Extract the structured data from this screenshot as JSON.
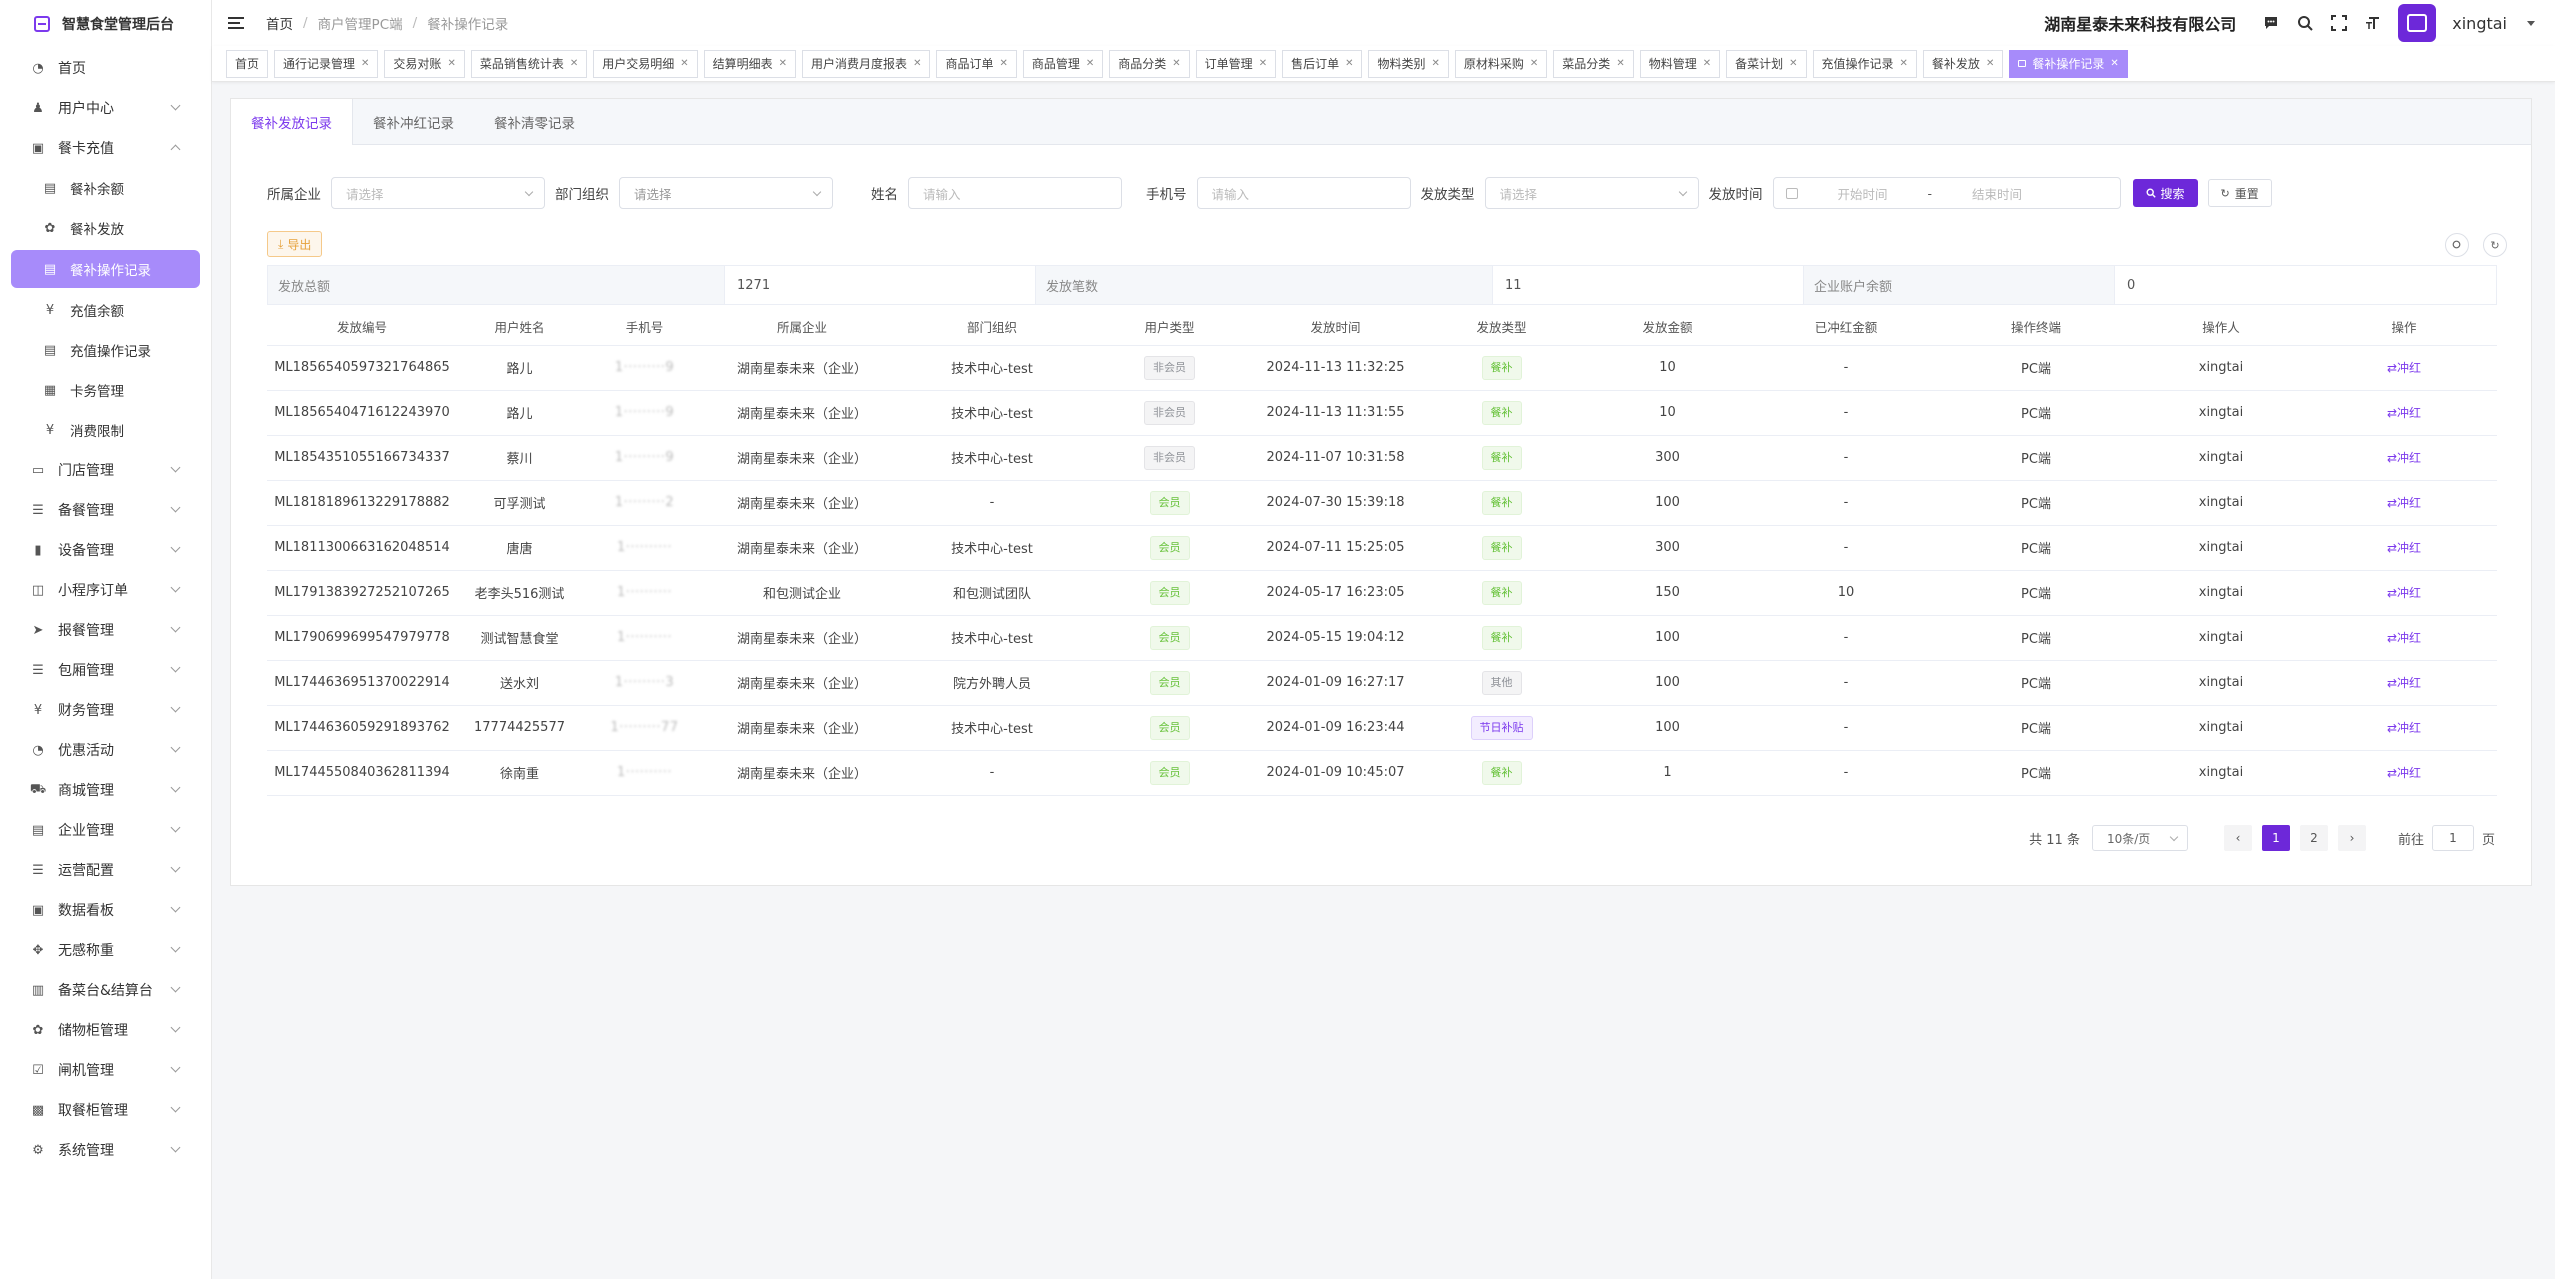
{
  "sidebar": {
    "app_title": "智慧食堂管理后台",
    "items": [
      {
        "label": "首页",
        "icon": "dashboard-icon",
        "glyph": "◔",
        "expand": ""
      },
      {
        "label": "用户中心",
        "icon": "user-icon",
        "glyph": "♟",
        "expand": "down"
      },
      {
        "label": "餐卡充值",
        "icon": "card-icon",
        "glyph": "▣",
        "expand": "up"
      },
      {
        "label": "餐补余额",
        "icon": "list-icon",
        "glyph": "▤",
        "sub": true
      },
      {
        "label": "餐补发放",
        "icon": "gear-icon",
        "glyph": "✿",
        "sub": true
      },
      {
        "label": "餐补操作记录",
        "icon": "record-icon",
        "glyph": "▤",
        "sub": true,
        "active": true
      },
      {
        "label": "充值余额",
        "icon": "yen-icon",
        "glyph": "¥",
        "sub": true
      },
      {
        "label": "充值操作记录",
        "icon": "record-icon",
        "glyph": "▤",
        "sub": true
      },
      {
        "label": "卡务管理",
        "icon": "card-icon",
        "glyph": "▦",
        "sub": true
      },
      {
        "label": "消费限制",
        "icon": "yen-icon",
        "glyph": "¥",
        "sub": true
      },
      {
        "label": "门店管理",
        "icon": "store-icon",
        "glyph": "▭",
        "expand": "down"
      },
      {
        "label": "备餐管理",
        "icon": "list-icon",
        "glyph": "☰",
        "expand": "down"
      },
      {
        "label": "设备管理",
        "icon": "chart-icon",
        "glyph": "▮",
        "expand": "down"
      },
      {
        "label": "小程序订单",
        "icon": "order-icon",
        "glyph": "◫",
        "expand": "down"
      },
      {
        "label": "报餐管理",
        "icon": "send-icon",
        "glyph": "➤",
        "expand": "down"
      },
      {
        "label": "包厢管理",
        "icon": "list-icon",
        "glyph": "☰",
        "expand": "down"
      },
      {
        "label": "财务管理",
        "icon": "yen-icon",
        "glyph": "¥",
        "expand": "down"
      },
      {
        "label": "优惠活动",
        "icon": "dashboard-icon",
        "glyph": "◔",
        "expand": "down"
      },
      {
        "label": "商城管理",
        "icon": "cart-icon",
        "glyph": "⛟",
        "expand": "down"
      },
      {
        "label": "企业管理",
        "icon": "building-icon",
        "glyph": "▤",
        "expand": "down"
      },
      {
        "label": "运营配置",
        "icon": "list-icon",
        "glyph": "☰",
        "expand": "down"
      },
      {
        "label": "数据看板",
        "icon": "board-icon",
        "glyph": "▣",
        "expand": "down"
      },
      {
        "label": "无感称重",
        "icon": "move-icon",
        "glyph": "✥",
        "expand": "down"
      },
      {
        "label": "备菜台&结算台",
        "icon": "desk-icon",
        "glyph": "▥",
        "expand": "down"
      },
      {
        "label": "储物柜管理",
        "icon": "gear-icon",
        "glyph": "✿",
        "expand": "down"
      },
      {
        "label": "闸机管理",
        "icon": "check-icon",
        "glyph": "☑",
        "expand": "down"
      },
      {
        "label": "取餐柜管理",
        "icon": "cabinet-icon",
        "glyph": "▩",
        "expand": "down"
      },
      {
        "label": "系统管理",
        "icon": "gear-icon",
        "glyph": "⚙",
        "expand": "down"
      }
    ]
  },
  "header": {
    "breadcrumb": [
      "首页",
      "商户管理PC端",
      "餐补操作记录"
    ],
    "company": "湖南星泰未来科技有限公司",
    "username": "xingtai"
  },
  "tags": [
    {
      "label": "首页",
      "closable": false
    },
    {
      "label": "通行记录管理",
      "closable": true
    },
    {
      "label": "交易对账",
      "closable": true
    },
    {
      "label": "菜品销售统计表",
      "closable": true
    },
    {
      "label": "用户交易明细",
      "closable": true
    },
    {
      "label": "结算明细表",
      "closable": true
    },
    {
      "label": "用户消费月度报表",
      "closable": true
    },
    {
      "label": "商品订单",
      "closable": true
    },
    {
      "label": "商品管理",
      "closable": true
    },
    {
      "label": "商品分类",
      "closable": true
    },
    {
      "label": "订单管理",
      "closable": true
    },
    {
      "label": "售后订单",
      "closable": true
    },
    {
      "label": "物料类别",
      "closable": true
    },
    {
      "label": "原材料采购",
      "closable": true
    },
    {
      "label": "菜品分类",
      "closable": true
    },
    {
      "label": "物料管理",
      "closable": true
    },
    {
      "label": "备菜计划",
      "closable": true
    },
    {
      "label": "充值操作记录",
      "closable": true
    },
    {
      "label": "餐补发放",
      "closable": true
    },
    {
      "label": "餐补操作记录",
      "closable": true,
      "active": true
    }
  ],
  "subtabs": [
    "餐补发放记录",
    "餐补冲红记录",
    "餐补清零记录"
  ],
  "filters": {
    "company_label": "所属企业",
    "company_placeholder": "请选择",
    "dept_label": "部门组织",
    "dept_placeholder": "请选择",
    "name_label": "姓名",
    "name_placeholder": "请输入",
    "phone_label": "手机号",
    "phone_placeholder": "请输入",
    "type_label": "发放类型",
    "type_placeholder": "请选择",
    "time_label": "发放时间",
    "start_placeholder": "开始时间",
    "range_sep": "-",
    "end_placeholder": "结束时间",
    "search_label": "搜索",
    "reset_label": "重置"
  },
  "export_label": "导出",
  "summary": {
    "total_label": "发放总额",
    "total_value": "1271",
    "count_label": "发放笔数",
    "count_value": "11",
    "balance_label": "企业账户余额",
    "balance_value": "0"
  },
  "table": {
    "columns": [
      "发放编号",
      "用户姓名",
      "手机号",
      "所属企业",
      "部门组织",
      "用户类型",
      "发放时间",
      "发放类型",
      "发放金额",
      "已冲红金额",
      "操作终端",
      "操作人",
      "操作"
    ],
    "rows": [
      {
        "id": "ML1856540597321764865",
        "name": "路儿",
        "phone": "1·········9",
        "company": "湖南星泰未来（企业）",
        "dept": "技术中心-test",
        "utype": "非会员",
        "ucolor": "gray",
        "time": "2024-11-13 11:32:25",
        "gtype": "餐补",
        "gcolor": "green",
        "amount": "10",
        "redamount": "-",
        "terminal": "PC端",
        "operator": "xingtai",
        "action": "冲红"
      },
      {
        "id": "ML1856540471612243970",
        "name": "路儿",
        "phone": "1·········9",
        "company": "湖南星泰未来（企业）",
        "dept": "技术中心-test",
        "utype": "非会员",
        "ucolor": "gray",
        "time": "2024-11-13 11:31:55",
        "gtype": "餐补",
        "gcolor": "green",
        "amount": "10",
        "redamount": "-",
        "terminal": "PC端",
        "operator": "xingtai",
        "action": "冲红"
      },
      {
        "id": "ML1854351055166734337",
        "name": "蔡川",
        "phone": "1·········9",
        "company": "湖南星泰未来（企业）",
        "dept": "技术中心-test",
        "utype": "非会员",
        "ucolor": "gray",
        "time": "2024-11-07 10:31:58",
        "gtype": "餐补",
        "gcolor": "green",
        "amount": "300",
        "redamount": "-",
        "terminal": "PC端",
        "operator": "xingtai",
        "action": "冲红"
      },
      {
        "id": "ML1818189613229178882",
        "name": "可孚测试",
        "phone": "1·········2",
        "company": "湖南星泰未来（企业）",
        "dept": "-",
        "utype": "会员",
        "ucolor": "green",
        "time": "2024-07-30 15:39:18",
        "gtype": "餐补",
        "gcolor": "green",
        "amount": "100",
        "redamount": "-",
        "terminal": "PC端",
        "operator": "xingtai",
        "action": "冲红"
      },
      {
        "id": "ML1811300663162048514",
        "name": "唐唐",
        "phone": "1··········",
        "company": "湖南星泰未来（企业）",
        "dept": "技术中心-test",
        "utype": "会员",
        "ucolor": "green",
        "time": "2024-07-11 15:25:05",
        "gtype": "餐补",
        "gcolor": "green",
        "amount": "300",
        "redamount": "-",
        "terminal": "PC端",
        "operator": "xingtai",
        "action": "冲红"
      },
      {
        "id": "ML1791383927252107265",
        "name": "老李头516测试",
        "phone": "1··········",
        "company": "和包测试企业",
        "dept": "和包测试团队",
        "utype": "会员",
        "ucolor": "green",
        "time": "2024-05-17 16:23:05",
        "gtype": "餐补",
        "gcolor": "green",
        "amount": "150",
        "redamount": "10",
        "terminal": "PC端",
        "operator": "xingtai",
        "action": "冲红"
      },
      {
        "id": "ML1790699699547979778",
        "name": "测试智慧食堂",
        "phone": "1··········",
        "company": "湖南星泰未来（企业）",
        "dept": "技术中心-test",
        "utype": "会员",
        "ucolor": "green",
        "time": "2024-05-15 19:04:12",
        "gtype": "餐补",
        "gcolor": "green",
        "amount": "100",
        "redamount": "-",
        "terminal": "PC端",
        "operator": "xingtai",
        "action": "冲红"
      },
      {
        "id": "ML1744636951370022914",
        "name": "送水刘",
        "phone": "1·········3",
        "company": "湖南星泰未来（企业）",
        "dept": "院方外聘人员",
        "utype": "会员",
        "ucolor": "green",
        "time": "2024-01-09 16:27:17",
        "gtype": "其他",
        "gcolor": "gray",
        "amount": "100",
        "redamount": "-",
        "terminal": "PC端",
        "operator": "xingtai",
        "action": "冲红"
      },
      {
        "id": "ML1744636059291893762",
        "name": "17774425577",
        "phone": "1·········77",
        "company": "湖南星泰未来（企业）",
        "dept": "技术中心-test",
        "utype": "会员",
        "ucolor": "green",
        "time": "2024-01-09 16:23:44",
        "gtype": "节日补贴",
        "gcolor": "purple",
        "amount": "100",
        "redamount": "-",
        "terminal": "PC端",
        "operator": "xingtai",
        "action": "冲红"
      },
      {
        "id": "ML1744550840362811394",
        "name": "徐南重",
        "phone": "1··········",
        "company": "湖南星泰未来（企业）",
        "dept": "-",
        "utype": "会员",
        "ucolor": "green",
        "time": "2024-01-09 10:45:07",
        "gtype": "餐补",
        "gcolor": "green",
        "amount": "1",
        "redamount": "-",
        "terminal": "PC端",
        "operator": "xingtai",
        "action": "冲红"
      }
    ]
  },
  "pagination": {
    "total_text": "共 11 条",
    "page_size": "10条/页",
    "pages": [
      "1",
      "2"
    ],
    "current": "1",
    "goto_prefix": "前往",
    "goto_value": "1",
    "goto_suffix": "页"
  },
  "colors": {
    "accent": "#6d28d9",
    "accent_light": "#a78bfa"
  }
}
